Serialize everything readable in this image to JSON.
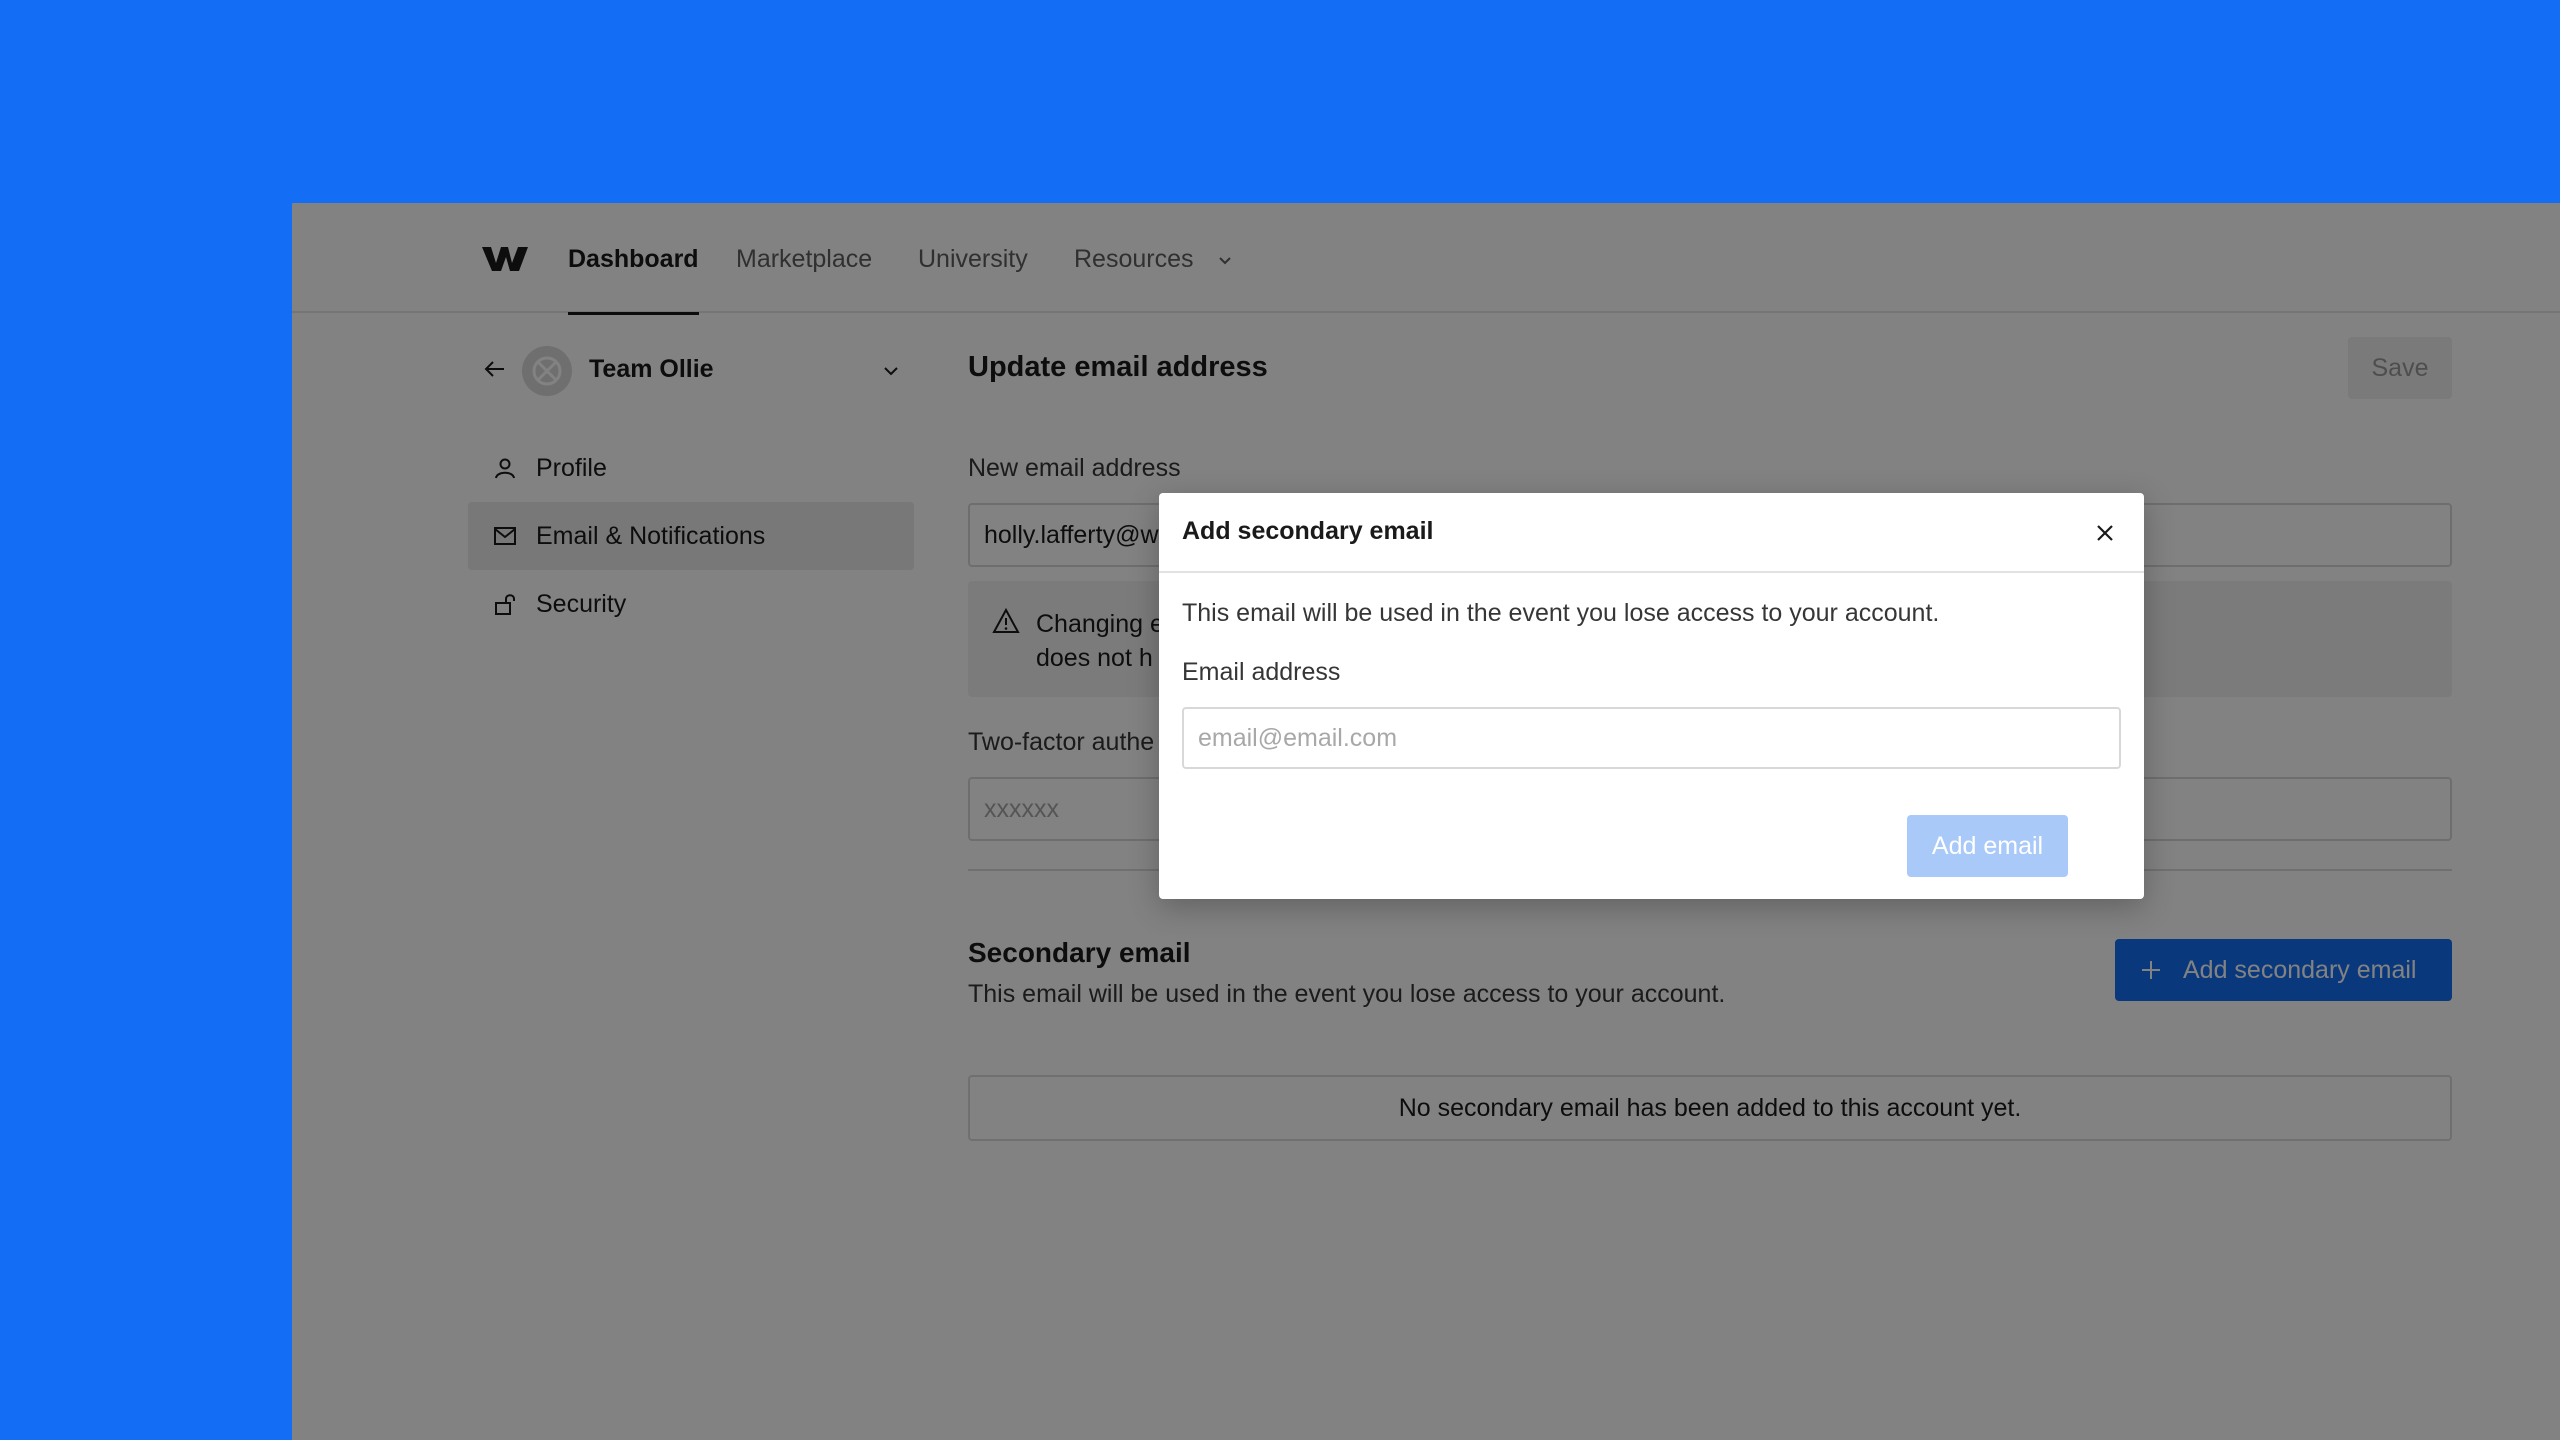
{
  "nav": {
    "logo_icon": "webflow-logo",
    "items": [
      {
        "label": "Dashboard",
        "active": true
      },
      {
        "label": "Marketplace",
        "active": false
      },
      {
        "label": "University",
        "active": false
      },
      {
        "label": "Resources",
        "active": false
      }
    ]
  },
  "sidebar": {
    "team_name": "Team Ollie",
    "items": [
      {
        "label": "Profile",
        "icon": "user-icon",
        "active": false
      },
      {
        "label": "Email & Notifications",
        "icon": "mail-icon",
        "active": true
      },
      {
        "label": "Security",
        "icon": "unlock-icon",
        "active": false
      }
    ]
  },
  "main": {
    "title": "Update email  address",
    "save_label": "Save",
    "new_email_label": "New email address",
    "new_email_value": "holly.lafferty@w",
    "warning_line1": "Changing e",
    "warning_line2": "does not h",
    "two_factor_label": "Two-factor authe",
    "two_factor_placeholder": "xxxxxx",
    "secondary_title": "Secondary email",
    "secondary_desc": "This email will be used in the event you lose access to your account.",
    "add_secondary_label": "Add secondary email",
    "empty_text": "No secondary email has been added to this account yet."
  },
  "modal": {
    "title": "Add secondary email",
    "description": "This email will be used in the event you lose access to your account.",
    "email_label": "Email address",
    "email_placeholder": "email@email.com",
    "add_button": "Add email"
  },
  "colors": {
    "background": "#146ef5",
    "accent": "#146ef5",
    "disabled_button": "#a9caf9"
  }
}
